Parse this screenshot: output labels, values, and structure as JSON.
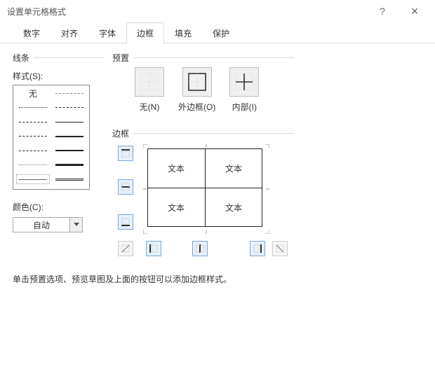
{
  "titlebar": {
    "title": "设置单元格格式",
    "help": "?",
    "close": "×"
  },
  "tabs": {
    "items": [
      "数字",
      "对齐",
      "字体",
      "边框",
      "填充",
      "保护"
    ],
    "active_index": 3
  },
  "groups": {
    "line": "线条",
    "preset": "预置",
    "border": "边框"
  },
  "line": {
    "style_label": "样式(S):",
    "none_label": "无",
    "color_label": "颜色(C):",
    "color_value": "自动"
  },
  "presets": {
    "none": "无(N)",
    "outline": "外边框(O)",
    "inside": "内部(I)"
  },
  "preview": {
    "cell_text": "文本"
  },
  "hint": "单击预置选项、预览草图及上面的按钮可以添加边框样式。"
}
